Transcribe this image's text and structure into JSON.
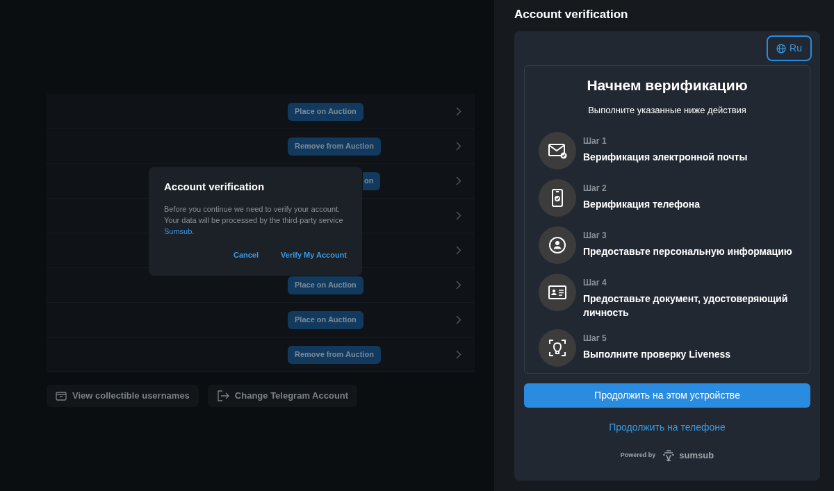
{
  "list": {
    "rows": [
      {
        "button": {
          "kind": "full",
          "label": "Place on Auction"
        }
      },
      {
        "button": {
          "kind": "full",
          "label": "Remove from Auction"
        }
      },
      {
        "button": {
          "kind": "clipped",
          "label": "on"
        }
      },
      {},
      {},
      {
        "button": {
          "kind": "full",
          "label": "Place on Auction"
        }
      },
      {
        "button": {
          "kind": "full",
          "label": "Place on Auction"
        }
      },
      {
        "button": {
          "kind": "full",
          "label": "Remove from Auction"
        }
      }
    ]
  },
  "actions": [
    "View collectible usernames",
    "Change Telegram Account"
  ],
  "dialog": {
    "title": "Account verification",
    "body": "Before you continue we need to verify your account. Your data will be processed by the third-party service ",
    "link": "Sumsub",
    "body_end": ".",
    "buttons": [
      "Cancel",
      "Verify My Account"
    ]
  },
  "panel": {
    "title": "Account verification",
    "language": "Ru",
    "heading": "Начнем верификацию",
    "subheading": "Выполните указанные ниже действия",
    "steps": [
      {
        "kind": "email",
        "label": "Шаг 1",
        "text": "Верификация электронной почты"
      },
      {
        "kind": "phone",
        "label": "Шаг 2",
        "text": "Верификация телефона"
      },
      {
        "kind": "person",
        "label": "Шаг 3",
        "text": "Предоставьте персональную информацию"
      },
      {
        "kind": "id",
        "label": "Шаг 4",
        "text": "Предоставьте документ, удостоверяющий личность"
      },
      {
        "kind": "face",
        "label": "Шаг 5",
        "text": "Выполните проверку Liveness"
      }
    ],
    "primary": "Продолжить на этом устройстве",
    "secondary": "Продолжить на телефоне",
    "powered": "Powered by",
    "brand": "sumsub"
  }
}
